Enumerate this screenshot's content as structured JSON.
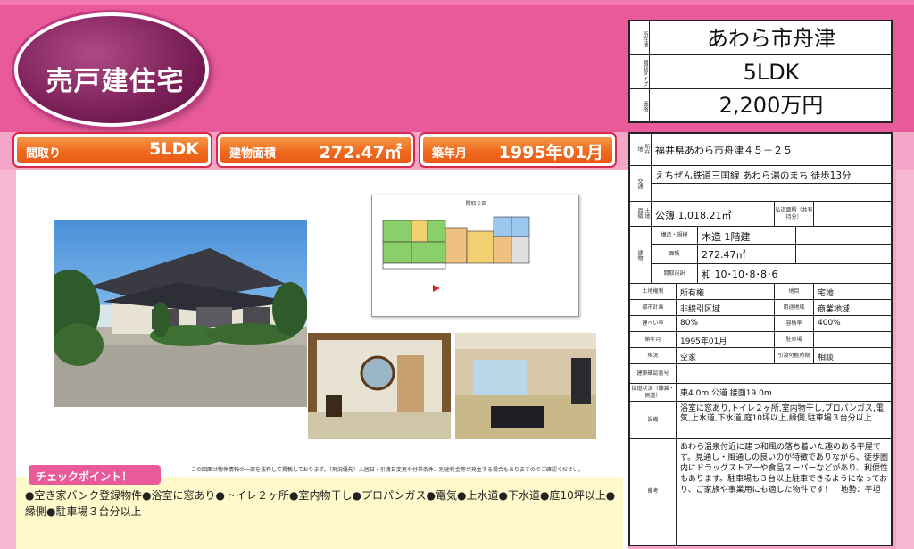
{
  "header": {
    "title": "売戸建住宅"
  },
  "badges": [
    {
      "label": "間取り",
      "value": "5LDK"
    },
    {
      "label": "建物面積",
      "value": "272.47㎡"
    },
    {
      "label": "築年月",
      "value": "1995年01月"
    }
  ],
  "top_table": {
    "location_label": "所在地",
    "location": "あわら市舟津",
    "layout_label": "間取タイプ",
    "layout": "5LDK",
    "price_label": "価格",
    "price": "2,200万円"
  },
  "floorplan": {
    "title": "間取り図"
  },
  "note": "この図面は物件情報の一部を抜粋して掲載しております。（現況優先）入居日・引渡日変更や付帯条件、別途料金等が発生する場合もありますのでご確認ください。",
  "checkpoint": {
    "header": "チェックポイント！",
    "text": "●空き家バンク登録物件●浴室に窓あり●トイレ２ヶ所●室内物干し●プロパンガス●電気●上水道●下水道●庭10坪以上●縁側●駐車場３台分以上"
  },
  "details": {
    "address_label": "物件所在地",
    "address": "福井県あわら市舟津４５－２５",
    "transport_label": "交通",
    "transport": "えちぜん鉄道三国線 あわら湯のまち 徒歩13分",
    "land_label": "土地面積",
    "land": "公簿 1,018.21㎡",
    "private_road_label": "私道面積（共有持分）",
    "building_label": "建物",
    "structure_label": "構造・規模",
    "structure": "木造 1階建",
    "area_label": "面積",
    "area": "272.47㎡",
    "rooms_label": "間取内訳",
    "rooms": "和 10･10･8･8･6",
    "land_right_label": "土地権利",
    "land_right": "所有権",
    "category_label": "地目",
    "category": "宅地",
    "city_plan_label": "都市計画",
    "city_plan": "非線引区域",
    "zoning_label": "用途地域",
    "zoning": "商業地域",
    "coverage_label": "建ぺい率",
    "coverage": "80%",
    "far_label": "容積率",
    "far": "400%",
    "built_label": "築年月",
    "built": "1995年01月",
    "parking_label": "駐車場",
    "status_label": "現況",
    "status": "空家",
    "handover_label": "引渡可能時期",
    "handover": "相談",
    "confirm_label": "建築確認番号",
    "road_label": "接道状況（舗装・側道）",
    "road": "東4.0m 公道 接面19.0m",
    "equipment_label": "設備",
    "equipment": "浴室に窓あり,トイレ２ヶ所,室内物干し,プロパンガス,電気,上水道,下水道,庭10坪以上,縁側,駐車場３台分以上",
    "remarks_label": "備考",
    "remarks": "あわら温泉付近に建つ和風の落ち着いた趣のある平屋です。見通し・風通しの良いのが特徴でありながら、徒歩圏内にドラッグストアーや食品スーパーなどがあり、利便性もあります。駐車場も３台以上駐車できるようになっており、ご家族や事業用にも適した物件です！　地勢：平坦"
  }
}
